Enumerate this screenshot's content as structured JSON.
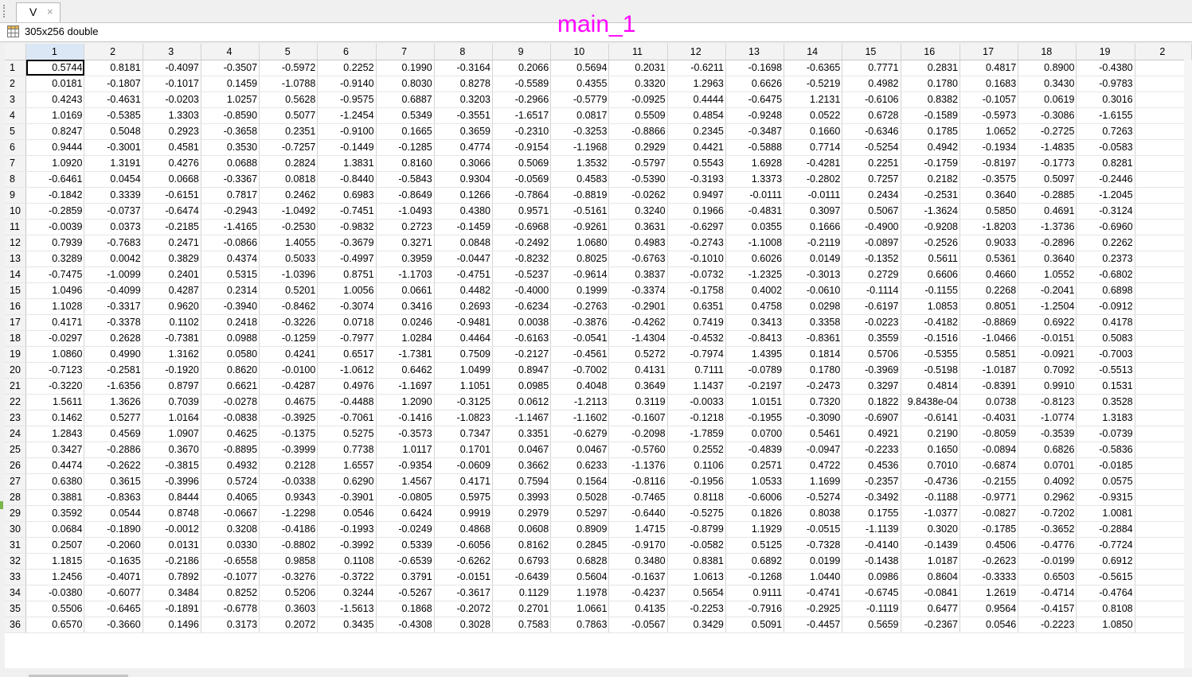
{
  "tab": {
    "label": "V",
    "close": "×"
  },
  "info": {
    "size_label": "305x256 double"
  },
  "title": "main_1",
  "columns": [
    "1",
    "2",
    "3",
    "4",
    "5",
    "6",
    "7",
    "8",
    "9",
    "10",
    "11",
    "12",
    "13",
    "14",
    "15",
    "16",
    "17",
    "18",
    "19",
    "2"
  ],
  "rows": [
    {
      "n": "1",
      "v": [
        "0.5744",
        "0.8181",
        "-0.4097",
        "-0.3507",
        "-0.5972",
        "0.2252",
        "0.1990",
        "-0.3164",
        "0.2066",
        "0.5694",
        "0.2031",
        "-0.6211",
        "-0.1698",
        "-0.6365",
        "0.7771",
        "0.2831",
        "0.4817",
        "0.8900",
        "-0.4380"
      ]
    },
    {
      "n": "2",
      "v": [
        "0.0181",
        "-0.1807",
        "-0.1017",
        "0.1459",
        "-1.0788",
        "-0.9140",
        "0.8030",
        "0.8278",
        "-0.5589",
        "0.4355",
        "0.3320",
        "1.2963",
        "0.6626",
        "-0.5219",
        "0.4982",
        "0.1780",
        "0.1683",
        "0.3430",
        "-0.9783"
      ]
    },
    {
      "n": "3",
      "v": [
        "0.4243",
        "-0.4631",
        "-0.0203",
        "1.0257",
        "0.5628",
        "-0.9575",
        "0.6887",
        "0.3203",
        "-0.2966",
        "-0.5779",
        "-0.0925",
        "0.4444",
        "-0.6475",
        "1.2131",
        "-0.6106",
        "0.8382",
        "-0.1057",
        "0.0619",
        "0.3016"
      ]
    },
    {
      "n": "4",
      "v": [
        "1.0169",
        "-0.5385",
        "1.3303",
        "-0.8590",
        "0.5077",
        "-1.2454",
        "0.5349",
        "-0.3551",
        "-1.6517",
        "0.0817",
        "0.5509",
        "0.4854",
        "-0.9248",
        "0.0522",
        "0.6728",
        "-0.1589",
        "-0.5973",
        "-0.3086",
        "-1.6155"
      ]
    },
    {
      "n": "5",
      "v": [
        "0.8247",
        "0.5048",
        "0.2923",
        "-0.3658",
        "0.2351",
        "-0.9100",
        "0.1665",
        "0.3659",
        "-0.2310",
        "-0.3253",
        "-0.8866",
        "0.2345",
        "-0.3487",
        "0.1660",
        "-0.6346",
        "0.1785",
        "1.0652",
        "-0.2725",
        "0.7263"
      ]
    },
    {
      "n": "6",
      "v": [
        "0.9444",
        "-0.3001",
        "0.4581",
        "0.3530",
        "-0.7257",
        "-0.1449",
        "-0.1285",
        "0.4774",
        "-0.9154",
        "-1.1968",
        "0.2929",
        "0.4421",
        "-0.5888",
        "0.7714",
        "-0.5254",
        "0.4942",
        "-0.1934",
        "-1.4835",
        "-0.0583"
      ]
    },
    {
      "n": "7",
      "v": [
        "1.0920",
        "1.3191",
        "0.4276",
        "0.0688",
        "0.2824",
        "1.3831",
        "0.8160",
        "0.3066",
        "0.5069",
        "1.3532",
        "-0.5797",
        "0.5543",
        "1.6928",
        "-0.4281",
        "0.2251",
        "-0.1759",
        "-0.8197",
        "-0.1773",
        "0.8281"
      ]
    },
    {
      "n": "8",
      "v": [
        "-0.6461",
        "0.0454",
        "0.0668",
        "-0.3367",
        "0.0818",
        "-0.8440",
        "-0.5843",
        "0.9304",
        "-0.0569",
        "0.4583",
        "-0.5390",
        "-0.3193",
        "1.3373",
        "-0.2802",
        "0.7257",
        "0.2182",
        "-0.3575",
        "0.5097",
        "-0.2446"
      ]
    },
    {
      "n": "9",
      "v": [
        "-0.1842",
        "0.3339",
        "-0.6151",
        "0.7817",
        "0.2462",
        "0.6983",
        "-0.8649",
        "0.1266",
        "-0.7864",
        "-0.8819",
        "-0.0262",
        "0.9497",
        "-0.0111",
        "-0.0111",
        "0.2434",
        "-0.2531",
        "0.3640",
        "-0.2885",
        "-1.2045"
      ]
    },
    {
      "n": "10",
      "v": [
        "-0.2859",
        "-0.0737",
        "-0.6474",
        "-0.2943",
        "-1.0492",
        "-0.7451",
        "-1.0493",
        "0.4380",
        "0.9571",
        "-0.5161",
        "0.3240",
        "0.1966",
        "-0.4831",
        "0.3097",
        "0.5067",
        "-1.3624",
        "0.5850",
        "0.4691",
        "-0.3124"
      ]
    },
    {
      "n": "11",
      "v": [
        "-0.0039",
        "0.0373",
        "-0.2185",
        "-1.4165",
        "-0.2530",
        "-0.9832",
        "0.2723",
        "-0.1459",
        "-0.6968",
        "-0.9261",
        "0.3631",
        "-0.6297",
        "0.0355",
        "0.1666",
        "-0.4900",
        "-0.9208",
        "-1.8203",
        "-1.3736",
        "-0.6960"
      ]
    },
    {
      "n": "12",
      "v": [
        "0.7939",
        "-0.7683",
        "0.2471",
        "-0.0866",
        "1.4055",
        "-0.3679",
        "0.3271",
        "0.0848",
        "-0.2492",
        "1.0680",
        "0.4983",
        "-0.2743",
        "-1.1008",
        "-0.2119",
        "-0.0897",
        "-0.2526",
        "0.9033",
        "-0.2896",
        "0.2262"
      ]
    },
    {
      "n": "13",
      "v": [
        "0.3289",
        "0.0042",
        "0.3829",
        "0.4374",
        "0.5033",
        "-0.4997",
        "0.3959",
        "-0.0447",
        "-0.8232",
        "0.8025",
        "-0.6763",
        "-0.1010",
        "0.6026",
        "0.0149",
        "-0.1352",
        "0.5611",
        "0.5361",
        "0.3640",
        "0.2373"
      ]
    },
    {
      "n": "14",
      "v": [
        "-0.7475",
        "-1.0099",
        "0.2401",
        "0.5315",
        "-1.0396",
        "0.8751",
        "-1.1703",
        "-0.4751",
        "-0.5237",
        "-0.9614",
        "0.3837",
        "-0.0732",
        "-1.2325",
        "-0.3013",
        "0.2729",
        "0.6606",
        "0.4660",
        "1.0552",
        "-0.6802"
      ]
    },
    {
      "n": "15",
      "v": [
        "1.0496",
        "-0.4099",
        "0.4287",
        "0.2314",
        "0.5201",
        "1.0056",
        "0.0661",
        "0.4482",
        "-0.4000",
        "0.1999",
        "-0.3374",
        "-0.1758",
        "0.4002",
        "-0.0610",
        "-0.1114",
        "-0.1155",
        "0.2268",
        "-0.2041",
        "0.6898"
      ]
    },
    {
      "n": "16",
      "v": [
        "1.1028",
        "-0.3317",
        "0.9620",
        "-0.3940",
        "-0.8462",
        "-0.3074",
        "0.3416",
        "0.2693",
        "-0.6234",
        "-0.2763",
        "-0.2901",
        "0.6351",
        "0.4758",
        "0.0298",
        "-0.6197",
        "1.0853",
        "0.8051",
        "-1.2504",
        "-0.0912"
      ]
    },
    {
      "n": "17",
      "v": [
        "0.4171",
        "-0.3378",
        "0.1102",
        "0.2418",
        "-0.3226",
        "0.0718",
        "0.0246",
        "-0.9481",
        "0.0038",
        "-0.3876",
        "-0.4262",
        "0.7419",
        "0.3413",
        "0.3358",
        "-0.0223",
        "-0.4182",
        "-0.8869",
        "0.6922",
        "0.4178"
      ]
    },
    {
      "n": "18",
      "v": [
        "-0.0297",
        "0.2628",
        "-0.7381",
        "0.0988",
        "-0.1259",
        "-0.7977",
        "1.0284",
        "0.4464",
        "-0.6163",
        "-0.0541",
        "-1.4304",
        "-0.4532",
        "-0.8413",
        "-0.8361",
        "0.3559",
        "-0.1516",
        "-1.0466",
        "-0.0151",
        "0.5083"
      ]
    },
    {
      "n": "19",
      "v": [
        "1.0860",
        "0.4990",
        "1.3162",
        "0.0580",
        "0.4241",
        "0.6517",
        "-1.7381",
        "0.7509",
        "-0.2127",
        "-0.4561",
        "0.5272",
        "-0.7974",
        "1.4395",
        "0.1814",
        "0.5706",
        "-0.5355",
        "0.5851",
        "-0.0921",
        "-0.7003"
      ]
    },
    {
      "n": "20",
      "v": [
        "-0.7123",
        "-0.2581",
        "-0.1920",
        "0.8620",
        "-0.0100",
        "-1.0612",
        "0.6462",
        "1.0499",
        "0.8947",
        "-0.7002",
        "0.4131",
        "0.7111",
        "-0.0789",
        "0.1780",
        "-0.3969",
        "-0.5198",
        "-1.0187",
        "0.7092",
        "-0.5513"
      ]
    },
    {
      "n": "21",
      "v": [
        "-0.3220",
        "-1.6356",
        "0.8797",
        "0.6621",
        "-0.4287",
        "0.4976",
        "-1.1697",
        "1.1051",
        "0.0985",
        "0.4048",
        "0.3649",
        "1.1437",
        "-0.2197",
        "-0.2473",
        "0.3297",
        "0.4814",
        "-0.8391",
        "0.9910",
        "0.1531"
      ]
    },
    {
      "n": "22",
      "v": [
        "1.5611",
        "1.3626",
        "0.7039",
        "-0.0278",
        "0.4675",
        "-0.4488",
        "1.2090",
        "-0.3125",
        "0.0612",
        "-1.2113",
        "0.3119",
        "-0.0033",
        "1.0151",
        "0.7320",
        "0.1822",
        "9.8438e-04",
        "0.0738",
        "-0.8123",
        "0.3528"
      ]
    },
    {
      "n": "23",
      "v": [
        "0.1462",
        "0.5277",
        "1.0164",
        "-0.0838",
        "-0.3925",
        "-0.7061",
        "-0.1416",
        "-1.0823",
        "-1.1467",
        "-1.1602",
        "-0.1607",
        "-0.1218",
        "-0.1955",
        "-0.3090",
        "-0.6907",
        "-0.6141",
        "-0.4031",
        "-1.0774",
        "1.3183"
      ]
    },
    {
      "n": "24",
      "v": [
        "1.2843",
        "0.4569",
        "1.0907",
        "0.4625",
        "-0.1375",
        "0.5275",
        "-0.3573",
        "0.7347",
        "0.3351",
        "-0.6279",
        "-0.2098",
        "-1.7859",
        "0.0700",
        "0.5461",
        "0.4921",
        "0.2190",
        "-0.8059",
        "-0.3539",
        "-0.0739"
      ]
    },
    {
      "n": "25",
      "v": [
        "0.3427",
        "-0.2886",
        "0.3670",
        "-0.8895",
        "-0.3999",
        "0.7738",
        "1.0117",
        "0.1701",
        "0.0467",
        "0.0467",
        "-0.5760",
        "0.2552",
        "-0.4839",
        "-0.0947",
        "-0.2233",
        "0.1650",
        "-0.0894",
        "0.6826",
        "-0.5836"
      ]
    },
    {
      "n": "26",
      "v": [
        "0.4474",
        "-0.2622",
        "-0.3815",
        "0.4932",
        "0.2128",
        "1.6557",
        "-0.9354",
        "-0.0609",
        "0.3662",
        "0.6233",
        "-1.1376",
        "0.1106",
        "0.2571",
        "0.4722",
        "0.4536",
        "0.7010",
        "-0.6874",
        "0.0701",
        "-0.0185"
      ]
    },
    {
      "n": "27",
      "v": [
        "0.6380",
        "0.3615",
        "-0.3996",
        "0.5724",
        "-0.0338",
        "0.6290",
        "1.4567",
        "0.4171",
        "0.7594",
        "0.1564",
        "-0.8116",
        "-0.1956",
        "1.0533",
        "1.1699",
        "-0.2357",
        "-0.4736",
        "-0.2155",
        "0.4092",
        "0.0575"
      ]
    },
    {
      "n": "28",
      "v": [
        "0.3881",
        "-0.8363",
        "0.8444",
        "0.4065",
        "0.9343",
        "-0.3901",
        "-0.0805",
        "0.5975",
        "0.3993",
        "0.5028",
        "-0.7465",
        "0.8118",
        "-0.6006",
        "-0.5274",
        "-0.3492",
        "-0.1188",
        "-0.9771",
        "0.2962",
        "-0.9315"
      ]
    },
    {
      "n": "29",
      "v": [
        "0.3592",
        "0.0544",
        "0.8748",
        "-0.0667",
        "-1.2298",
        "0.0546",
        "0.6424",
        "0.9919",
        "0.2979",
        "0.5297",
        "-0.6440",
        "-0.5275",
        "0.1826",
        "0.8038",
        "0.1755",
        "-1.0377",
        "-0.0827",
        "-0.7202",
        "1.0081"
      ]
    },
    {
      "n": "30",
      "v": [
        "0.0684",
        "-0.1890",
        "-0.0012",
        "0.3208",
        "-0.4186",
        "-0.1993",
        "-0.0249",
        "0.4868",
        "0.0608",
        "0.8909",
        "1.4715",
        "-0.8799",
        "1.1929",
        "-0.0515",
        "-1.1139",
        "0.3020",
        "-0.1785",
        "-0.3652",
        "-0.2884"
      ]
    },
    {
      "n": "31",
      "v": [
        "0.2507",
        "-0.2060",
        "0.0131",
        "0.0330",
        "-0.8802",
        "-0.3992",
        "0.5339",
        "-0.6056",
        "0.8162",
        "0.2845",
        "-0.9170",
        "-0.0582",
        "0.5125",
        "-0.7328",
        "-0.4140",
        "-0.1439",
        "0.4506",
        "-0.4776",
        "-0.7724"
      ]
    },
    {
      "n": "32",
      "v": [
        "1.1815",
        "-0.1635",
        "-0.2186",
        "-0.6558",
        "0.9858",
        "0.1108",
        "-0.6539",
        "-0.6262",
        "0.6793",
        "0.6828",
        "0.3480",
        "0.8381",
        "0.6892",
        "0.0199",
        "-0.1438",
        "1.0187",
        "-0.2623",
        "-0.0199",
        "0.6912"
      ]
    },
    {
      "n": "33",
      "v": [
        "1.2456",
        "-0.4071",
        "0.7892",
        "-0.1077",
        "-0.3276",
        "-0.3722",
        "0.3791",
        "-0.0151",
        "-0.6439",
        "0.5604",
        "-0.1637",
        "1.0613",
        "-0.1268",
        "1.0440",
        "0.0986",
        "0.8604",
        "-0.3333",
        "0.6503",
        "-0.5615"
      ]
    },
    {
      "n": "34",
      "v": [
        "-0.0380",
        "-0.6077",
        "0.3484",
        "0.8252",
        "0.5206",
        "0.3244",
        "-0.5267",
        "-0.3617",
        "0.1129",
        "1.1978",
        "-0.4237",
        "0.5654",
        "0.9111",
        "-0.4741",
        "-0.6745",
        "-0.0841",
        "1.2619",
        "-0.4714",
        "-0.4764"
      ]
    },
    {
      "n": "35",
      "v": [
        "0.5506",
        "-0.6465",
        "-0.1891",
        "-0.6778",
        "0.3603",
        "-1.5613",
        "0.1868",
        "-0.2072",
        "0.2701",
        "1.0661",
        "0.4135",
        "-0.2253",
        "-0.7916",
        "-0.2925",
        "-0.1119",
        "0.6477",
        "0.9564",
        "-0.4157",
        "0.8108"
      ]
    },
    {
      "n": "36",
      "v": [
        "0.6570",
        "-0.3660",
        "0.1496",
        "0.3173",
        "0.2072",
        "0.3435",
        "-0.4308",
        "0.3028",
        "0.7583",
        "0.7863",
        "-0.0567",
        "0.3429",
        "0.5091",
        "-0.4457",
        "0.5659",
        "-0.2367",
        "0.0546",
        "-0.2223",
        "1.0850"
      ]
    }
  ],
  "colors": {
    "title": "#ff00ff",
    "header_bg": "#f3f3f3",
    "grid_line": "#d4d4d4"
  }
}
